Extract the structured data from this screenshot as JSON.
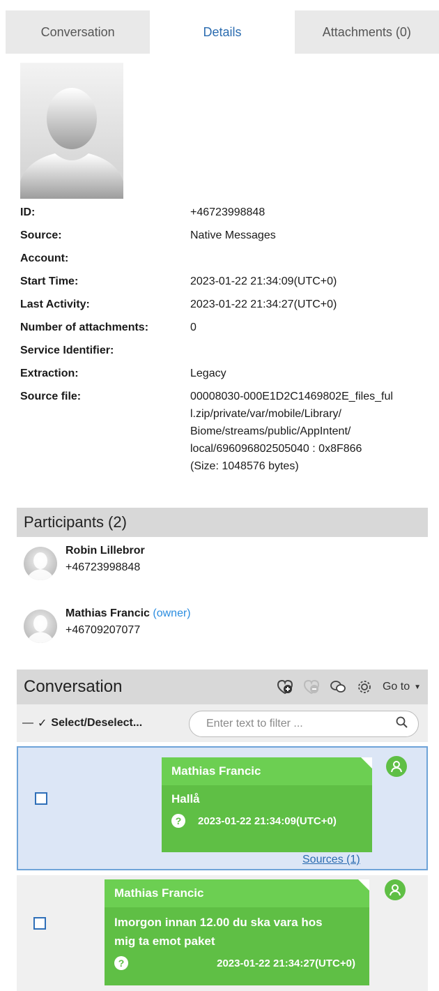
{
  "tabs": [
    {
      "label": "Conversation"
    },
    {
      "label": "Details"
    },
    {
      "label": "Attachments (0)"
    }
  ],
  "details": {
    "id_k": "ID:",
    "id_v": "+46723998848",
    "source_k": "Source:",
    "source_v": "Native Messages",
    "account_k": "Account:",
    "account_v": "",
    "start_k": "Start Time:",
    "start_v": "2023-01-22 21:34:09(UTC+0)",
    "last_k": "Last Activity:",
    "last_v": "2023-01-22 21:34:27(UTC+0)",
    "att_k": "Number of attachments:",
    "att_v": "0",
    "svc_k": "Service Identifier:",
    "svc_v": "",
    "ext_k": "Extraction:",
    "ext_v": "Legacy",
    "file_k": "Source file:",
    "file_v1": "00008030-000E1D2C1469802E_files_ful",
    "file_v2": "l.zip/private/var/mobile/Library/",
    "file_v3": "Biome/streams/public/AppIntent/",
    "file_v4": "local/696096802505040 : 0x8F866",
    "file_v5": "(Size: 1048576 bytes)"
  },
  "participants": {
    "title": "Participants (2)",
    "items": [
      {
        "name": "Robin  Lillebror",
        "owner": "",
        "phone": "+46723998848"
      },
      {
        "name": "Mathias Francic",
        "owner": "(owner)",
        "phone": "+46709207077"
      }
    ]
  },
  "conversation": {
    "title": "Conversation",
    "goto_label": "Go to",
    "select_label": "Select/Deselect...",
    "filter_placeholder": "Enter text to filter ...",
    "messages": [
      {
        "sender": "Mathias Francic",
        "text": "Hallå",
        "time": "2023-01-22 21:34:09(UTC+0)",
        "sources": "Sources (1)"
      },
      {
        "sender": "Mathias Francic",
        "text_line1": "Imorgon innan 12.00 du ska vara hos",
        "text_line2": "mig ta emot paket",
        "time": "2023-01-22 21:34:27(UTC+0)"
      }
    ]
  },
  "colors": {
    "bubble": "#5fbf45",
    "bubble_header": "#6ccf52",
    "selected_row": "#dce6f6",
    "link": "#2b6cb0"
  }
}
